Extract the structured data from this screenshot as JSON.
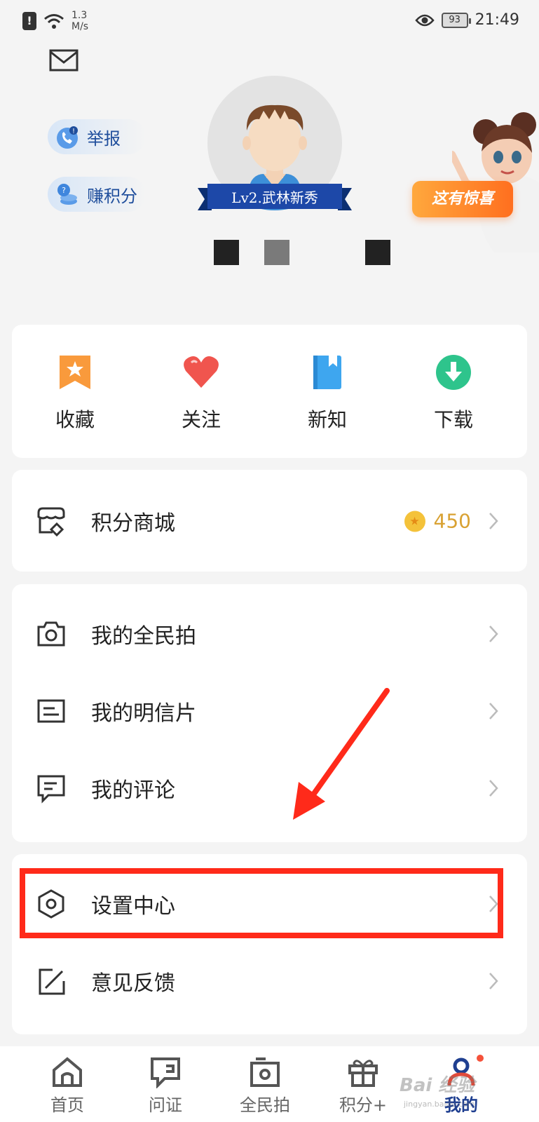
{
  "status_bar": {
    "net_speed_value": "1.3",
    "net_speed_unit": "M/s",
    "battery": "93",
    "time": "21:49"
  },
  "header": {
    "report_label": "举报",
    "earn_points_label": "赚积分",
    "level_badge": "Lv2.武林新秀",
    "promo_label": "这有惊喜"
  },
  "quick_actions": [
    {
      "label": "收藏",
      "icon": "bookmark-star-icon",
      "color": "#f99a3c"
    },
    {
      "label": "关注",
      "icon": "heart-icon",
      "color": "#f0554e"
    },
    {
      "label": "新知",
      "icon": "book-icon",
      "color": "#3ea6ef"
    },
    {
      "label": "下载",
      "icon": "download-icon",
      "color": "#2ec48c"
    }
  ],
  "points_mall": {
    "label": "积分商城",
    "points": "450"
  },
  "my_items": [
    {
      "label": "我的全民拍",
      "icon": "camera-icon"
    },
    {
      "label": "我的明信片",
      "icon": "postcard-icon"
    },
    {
      "label": "我的评论",
      "icon": "comment-icon"
    }
  ],
  "settings_items": [
    {
      "label": "设置中心",
      "icon": "settings-hexagon-icon"
    },
    {
      "label": "意见反馈",
      "icon": "feedback-edit-icon"
    }
  ],
  "bottom_nav": [
    {
      "label": "首页",
      "icon": "home-icon"
    },
    {
      "label": "问证",
      "icon": "inquiry-icon"
    },
    {
      "label": "全民拍",
      "icon": "camera-frame-icon"
    },
    {
      "label": "积分+",
      "icon": "gift-icon"
    },
    {
      "label": "我的",
      "icon": "profile-icon",
      "active": true
    }
  ],
  "watermark": {
    "text": "Bai 经验",
    "sub": "jingyan.baidu.com"
  },
  "colors": {
    "accent_blue": "#1f4e9c",
    "highlight_red": "#ff2a1a",
    "points_gold": "#d9a233"
  }
}
